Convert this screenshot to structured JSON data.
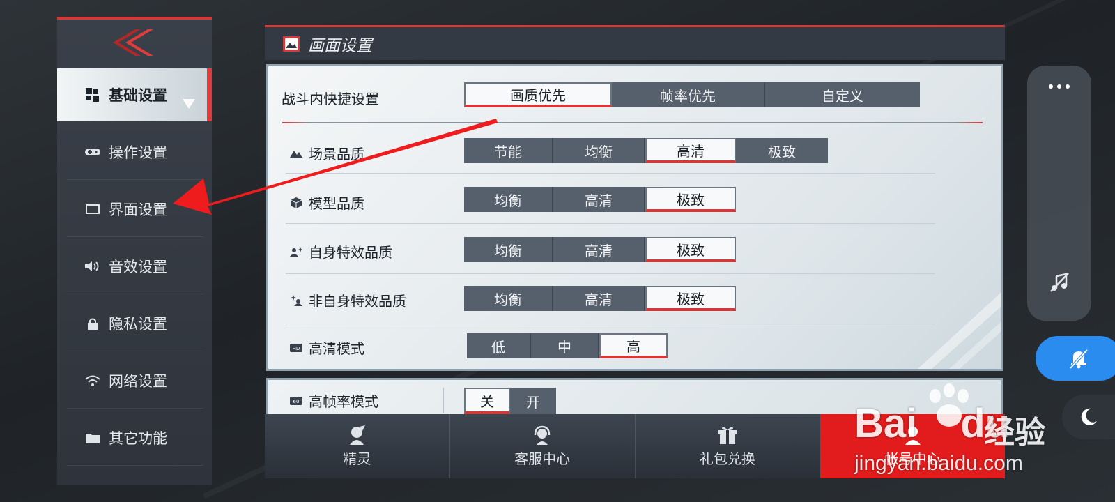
{
  "sidebar": {
    "items": [
      {
        "label": "基础设置",
        "icon": "grid-blocks-icon",
        "active": true
      },
      {
        "label": "操作设置",
        "icon": "gamepad-icon"
      },
      {
        "label": "界面设置",
        "icon": "screen-rect-icon"
      },
      {
        "label": "音效设置",
        "icon": "speaker-icon"
      },
      {
        "label": "隐私设置",
        "icon": "lock-icon"
      },
      {
        "label": "网络设置",
        "icon": "wifi-icon"
      },
      {
        "label": "其它功能",
        "icon": "folder-icon"
      }
    ]
  },
  "panel": {
    "title": "画面设置",
    "quick": {
      "label": "战斗内快捷设置",
      "options": [
        "画质优先",
        "帧率优先",
        "自定义"
      ],
      "selected": 0
    },
    "rows": [
      {
        "label": "场景品质",
        "icon": "mountain-icon",
        "options": [
          "节能",
          "均衡",
          "高清",
          "极致"
        ],
        "selected": 2
      },
      {
        "label": "模型品质",
        "icon": "cube-icon",
        "options": [
          "均衡",
          "高清",
          "极致"
        ],
        "selected": 2
      },
      {
        "label": "自身特效品质",
        "icon": "self-effect-icon",
        "options": [
          "均衡",
          "高清",
          "极致"
        ],
        "selected": 2
      },
      {
        "label": "非自身特效品质",
        "icon": "other-effect-icon",
        "options": [
          "均衡",
          "高清",
          "极致"
        ],
        "selected": 2
      },
      {
        "label": "高清模式",
        "icon": "hd-icon",
        "options": [
          "低",
          "中",
          "高"
        ],
        "selected": 2
      },
      {
        "label": "高帧率模式",
        "icon": "fps60-icon",
        "options": [
          "关",
          "开"
        ],
        "selected": 0
      }
    ]
  },
  "bottom_bar": {
    "items": [
      {
        "label": "精灵",
        "icon": "sprite-icon"
      },
      {
        "label": "客服中心",
        "icon": "headset-icon"
      },
      {
        "label": "礼包兑换",
        "icon": "gift-icon"
      },
      {
        "label": "帐号中心",
        "icon": "account-icon"
      }
    ]
  },
  "floating": {
    "more_icon": "more-dots-icon",
    "music_off_icon": "music-off-icon",
    "mute_icon": "bell-off-icon",
    "night_icon": "moon-icon"
  },
  "watermark": {
    "brand": "Bai",
    "brand2": "du",
    "cn": "经验",
    "url": "jingyan.baidu.com"
  },
  "colors": {
    "accent_red": "#d23a3a",
    "selected_bg": "#f7f9fa",
    "option_bg": "#56606c",
    "mute_blue": "#2b8cf0"
  }
}
